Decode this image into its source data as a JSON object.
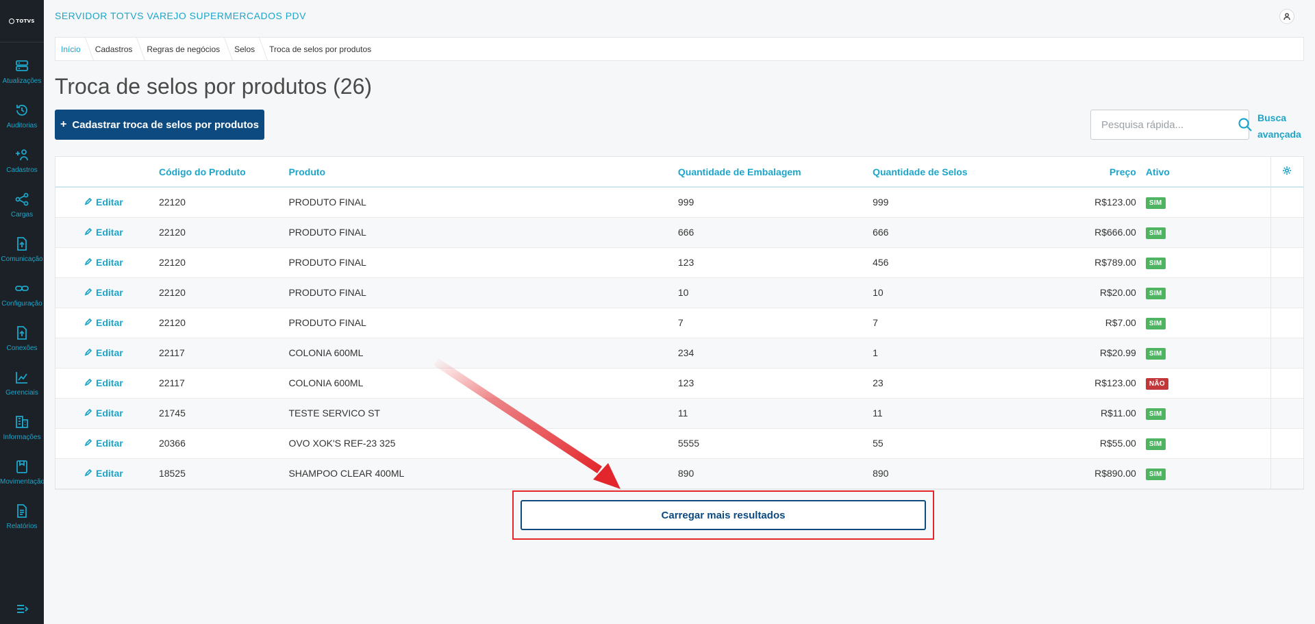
{
  "app": {
    "logo_text": "TOTVS",
    "title": "SERVIDOR TOTVS VAREJO SUPERMERCADOS PDV"
  },
  "sidebar": {
    "items": [
      {
        "label": "Atualizações",
        "icon": "server-icon"
      },
      {
        "label": "Auditorias",
        "icon": "history-icon"
      },
      {
        "label": "Cadastros",
        "icon": "add-user-icon"
      },
      {
        "label": "Cargas",
        "icon": "share-icon"
      },
      {
        "label": "Comunicação",
        "icon": "upload-file-icon"
      },
      {
        "label": "Configuração",
        "icon": "link-icon"
      },
      {
        "label": "Conexões",
        "icon": "upload-file-icon"
      },
      {
        "label": "Gerenciais",
        "icon": "chart-icon"
      },
      {
        "label": "Informações",
        "icon": "building-icon"
      },
      {
        "label": "Movimentação",
        "icon": "clipboard-icon"
      },
      {
        "label": "Relatórios",
        "icon": "document-icon"
      }
    ]
  },
  "breadcrumb": [
    "Início",
    "Cadastros",
    "Regras de negócios",
    "Selos",
    "Troca de selos por produtos"
  ],
  "page": {
    "title": "Troca de selos por produtos (26)",
    "add_button": "Cadastrar troca de selos por produtos",
    "add_button_plus": "+",
    "search_placeholder": "Pesquisa rápida...",
    "advanced_search": "Busca avançada",
    "load_more": "Carregar mais resultados"
  },
  "table": {
    "columns": [
      "Código do Produto",
      "Produto",
      "Quantidade de Embalagem",
      "Quantidade de Selos",
      "Preço",
      "Ativo"
    ],
    "edit_label": "Editar",
    "rows": [
      {
        "code": "22120",
        "product": "PRODUTO FINAL",
        "qty_pack": "999",
        "qty_seals": "999",
        "price": "R$123.00",
        "active": "SIM"
      },
      {
        "code": "22120",
        "product": "PRODUTO FINAL",
        "qty_pack": "666",
        "qty_seals": "666",
        "price": "R$666.00",
        "active": "SIM"
      },
      {
        "code": "22120",
        "product": "PRODUTO FINAL",
        "qty_pack": "123",
        "qty_seals": "456",
        "price": "R$789.00",
        "active": "SIM"
      },
      {
        "code": "22120",
        "product": "PRODUTO FINAL",
        "qty_pack": "10",
        "qty_seals": "10",
        "price": "R$20.00",
        "active": "SIM"
      },
      {
        "code": "22120",
        "product": "PRODUTO FINAL",
        "qty_pack": "7",
        "qty_seals": "7",
        "price": "R$7.00",
        "active": "SIM"
      },
      {
        "code": "22117",
        "product": "COLONIA 600ML",
        "qty_pack": "234",
        "qty_seals": "1",
        "price": "R$20.99",
        "active": "SIM"
      },
      {
        "code": "22117",
        "product": "COLONIA 600ML",
        "qty_pack": "123",
        "qty_seals": "23",
        "price": "R$123.00",
        "active": "NÃO"
      },
      {
        "code": "21745",
        "product": "TESTE SERVICO ST",
        "qty_pack": "11",
        "qty_seals": "11",
        "price": "R$11.00",
        "active": "SIM"
      },
      {
        "code": "20366",
        "product": "OVO XOK'S REF-23 325",
        "qty_pack": "5555",
        "qty_seals": "55",
        "price": "R$55.00",
        "active": "SIM"
      },
      {
        "code": "18525",
        "product": "SHAMPOO CLEAR 400ML",
        "qty_pack": "890",
        "qty_seals": "890",
        "price": "R$890.00",
        "active": "SIM"
      }
    ]
  },
  "colors": {
    "accent": "#1da5c9",
    "primary": "#0c4a80",
    "sidebar_bg": "#1b2127",
    "badge_yes": "#4eb461",
    "badge_no": "#c2383a",
    "highlight": "#e2262b"
  }
}
